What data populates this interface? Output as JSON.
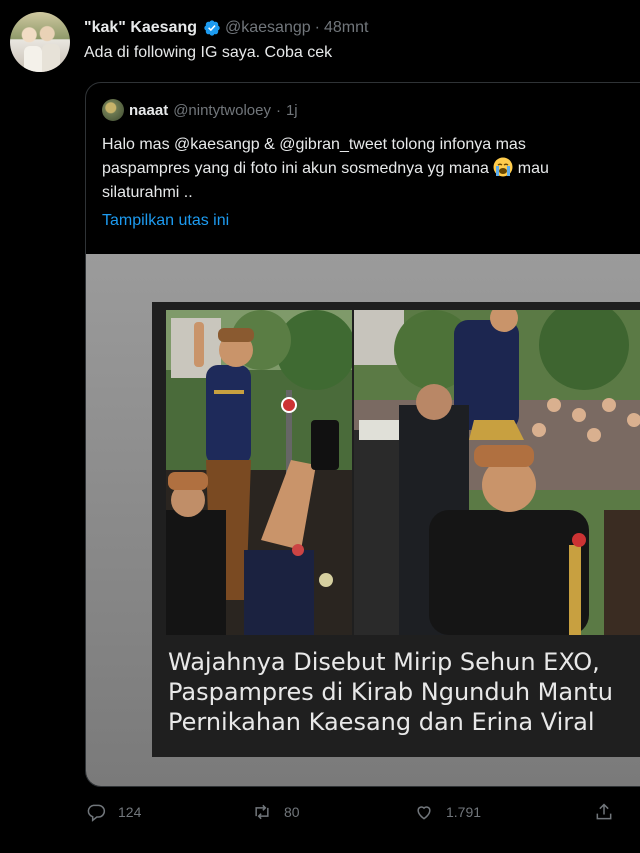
{
  "tweet": {
    "author_name": "\"kak\" Kaesang",
    "author_handle": "@kaesangp",
    "separator": "·",
    "time": "48mnt",
    "text": "Ada di following IG saya. Coba cek"
  },
  "quoted": {
    "author_name": "naaat",
    "author_handle": "@nintytwoloey",
    "separator": "·",
    "time": "1j",
    "text_line1": "Halo mas @kaesangp   & @gibran_tweet tolong infonya mas",
    "text_line2_a": "paspampres yang di foto ini akun sosmednya yg mana",
    "text_line2_b": "mau",
    "text_line3": "silaturahmi ..",
    "show_thread": "Tampilkan utas ini",
    "caption": [
      "Wajahnya Disebut Mirip Sehun EXO,",
      "Paspampres di Kirab Ngunduh Mantu",
      "Pernikahan Kaesang dan Erina Viral"
    ]
  },
  "actions": {
    "reply_count": "124",
    "retweet_count": "80",
    "like_count": "1.791"
  },
  "colors": {
    "background": "#000000",
    "text": "#e7e9ea",
    "secondary": "#71767b",
    "link": "#1d9bf0",
    "verified": "#1d9bf0"
  },
  "icons": [
    "verified-badge-icon",
    "crying-face-emoji",
    "reply-icon",
    "retweet-icon",
    "like-icon",
    "share-icon"
  ]
}
